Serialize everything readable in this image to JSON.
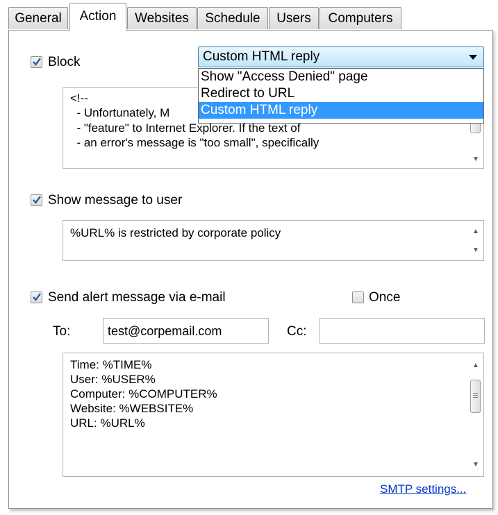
{
  "tabs": [
    "General",
    "Action",
    "Websites",
    "Schedule",
    "Users",
    "Computers"
  ],
  "active_tab": "Action",
  "block": {
    "checked": true,
    "label": "Block",
    "mode_selected": "Custom HTML reply",
    "mode_options": [
      "Show \"Access Denied\" page",
      "Redirect to URL",
      "Custom HTML reply"
    ],
    "html_lines": [
      "<!--",
      "  - Unfortunately, M",
      "  - \"feature\" to Internet Explorer. If the text of",
      "  - an error's message is \"too small\", specifically"
    ]
  },
  "show_message": {
    "checked": true,
    "label": "Show message to user",
    "text": "%URL% is restricted by corporate policy"
  },
  "alert": {
    "checked": true,
    "label": "Send alert message via e-mail",
    "once_checked": false,
    "once_label": "Once",
    "to_label": "To:",
    "to_value": "test@corpemail.com",
    "cc_label": "Cc:",
    "cc_value": "",
    "body_lines": [
      "Time: %TIME%",
      "User: %USER%",
      "Computer: %COMPUTER%",
      "Website: %WEBSITE%",
      "URL: %URL%"
    ]
  },
  "smtp_link": "SMTP settings..."
}
